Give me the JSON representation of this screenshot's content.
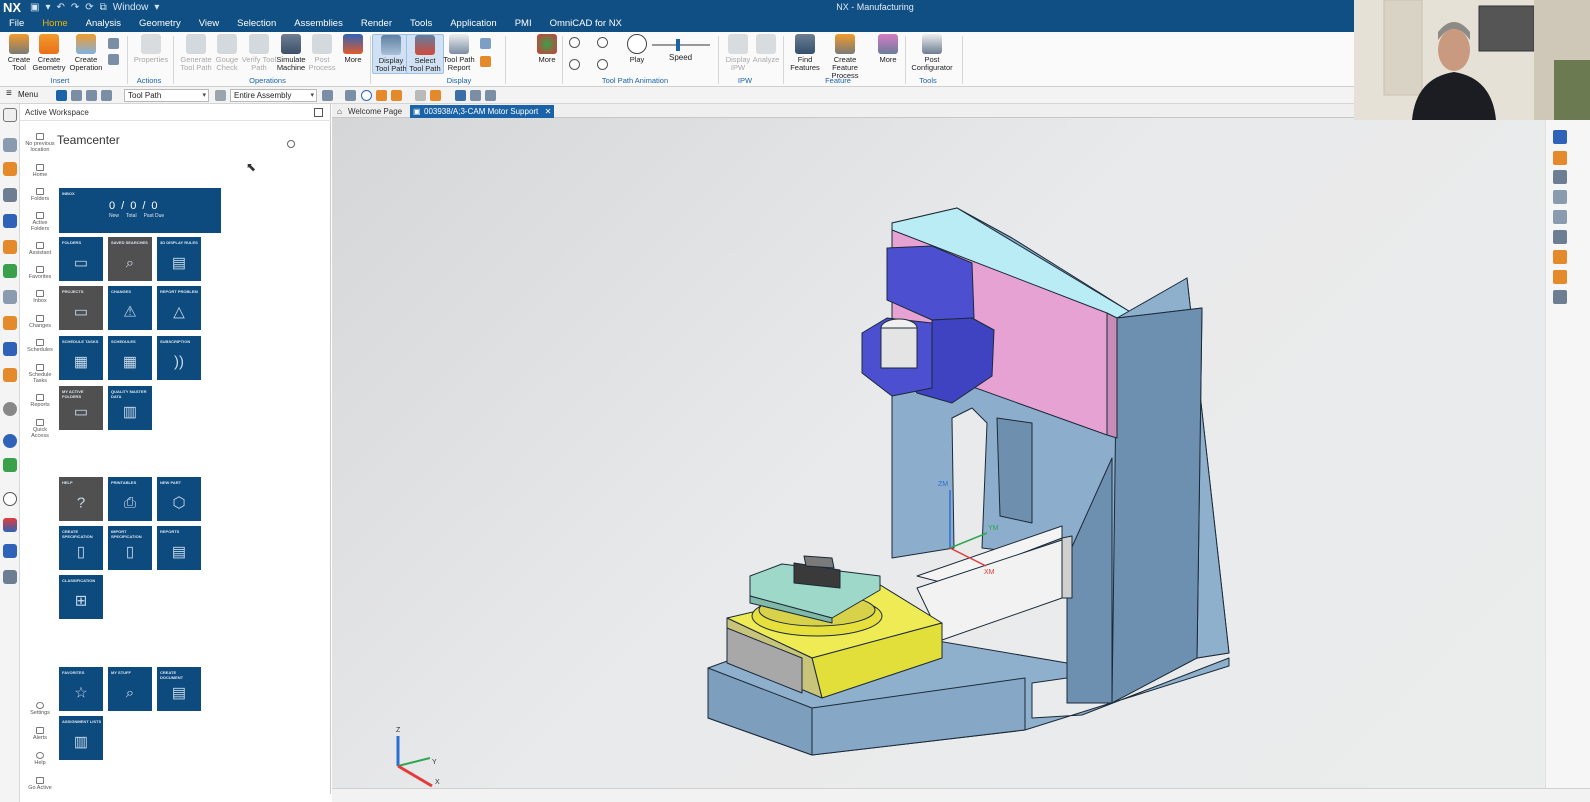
{
  "titlebar": {
    "app": "NX",
    "window_menu": "Window",
    "title": "NX - Manufacturing"
  },
  "menu_tabs": [
    "File",
    "Home",
    "Analysis",
    "Geometry",
    "View",
    "Selection",
    "Assemblies",
    "Render",
    "Tools",
    "Application",
    "PMI",
    "OmniCAD for NX"
  ],
  "ribbon": {
    "create_tool": "Create Tool",
    "create_geometry": "Create Geometry",
    "create_operation": "Create Operation",
    "properties": "Properties",
    "generate_tool_path": "Generate Tool Path",
    "gouge_check": "Gouge Check",
    "verify_tool_path": "Verify Tool Path",
    "simulate_machine": "Simulate Machine",
    "post_process": "Post Process",
    "more1": "More",
    "display_tool_path": "Display Tool Path",
    "select_tool_path": "Select Tool Path",
    "tool_path_report": "Tool Path Report",
    "more2": "More",
    "play": "Play",
    "speed": "Speed",
    "display_ipw": "Display IPW",
    "analyze": "Analyze",
    "find_features": "Find Features",
    "create_feature_process": "Create Feature Process",
    "more3": "More",
    "post_configurator": "Post Configurator",
    "groups": {
      "insert": "Insert",
      "actions": "Actions",
      "operations": "Operations",
      "display": "Display",
      "animation": "Tool Path Animation",
      "ipw": "IPW",
      "feature": "Feature",
      "tools": "Tools"
    }
  },
  "toolbar2": {
    "menu": "Menu",
    "filter": "Tool Path",
    "scope": "Entire Assembly"
  },
  "navigator": {
    "header": "Active Workspace",
    "app_title": "Teamcenter",
    "nav_items": [
      "No previous location",
      "Home",
      "Folders",
      "Active Folders",
      "Assistant",
      "Favorites",
      "Inbox",
      "Changes",
      "Schedules",
      "Schedule Tasks",
      "Reports",
      "Quick Access"
    ],
    "bottom_items": [
      "Settings",
      "Alerts",
      "Help",
      "Go Active"
    ],
    "inbox": {
      "title": "Inbox",
      "new": "0",
      "total": "0",
      "past_due": "0",
      "new_label": "New",
      "total_label": "Total",
      "past_due_label": "Past Due"
    },
    "tiles": [
      "Folders",
      "Saved Searches",
      "3D Display Rules",
      "Projects",
      "Changes",
      "Report Problem",
      "Schedule Tasks",
      "Schedules",
      "Subscription",
      "My Active Folders",
      "Quality Master Data",
      "Help",
      "Printables",
      "New Part",
      "Create Specification",
      "Import Specification",
      "Reports",
      "Classification",
      "Favorites",
      "My Stuff",
      "Create Document",
      "Assignment Lists"
    ]
  },
  "doc_tabs": {
    "welcome": "Welcome Page",
    "active": "003938/A;3-CAM Motor Support",
    "close": "✕"
  },
  "viewport": {
    "wcs_z": "ZM",
    "wcs_x": "XM",
    "wcs_y": "YM",
    "triad_z": "Z",
    "triad_y": "Y",
    "triad_x": "X"
  },
  "colors": {
    "title_bar": "#0f4f83",
    "tile_blue": "#0d4a7e",
    "tile_gray": "#505050",
    "accent": "#f0b400",
    "base": "#8fb0cd",
    "cyan": "#b9ecf4",
    "pink": "#e6a2d2",
    "yellow": "#e9e64a",
    "teal": "#9ed8c8",
    "purple": "#4b4fd0"
  }
}
